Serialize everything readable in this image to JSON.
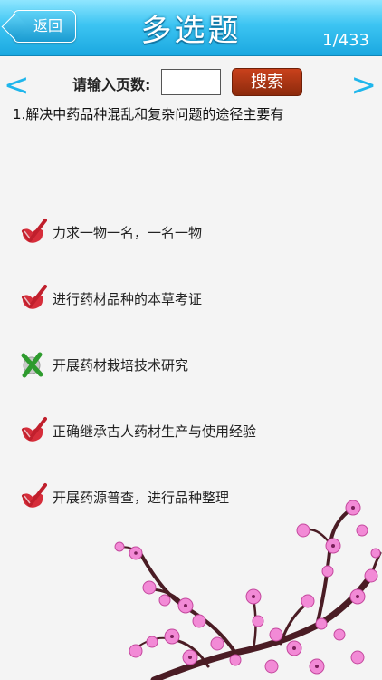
{
  "header": {
    "back_label": "返回",
    "title": "多选题",
    "page_count": "1/433"
  },
  "nav": {
    "prev_label": "<",
    "next_label": ">"
  },
  "search": {
    "page_label": "请输入页数:",
    "input_value": "",
    "button_label": "搜索"
  },
  "question": {
    "text": "1.解决中药品种混乱和复杂问题的途径主要有"
  },
  "options": [
    {
      "text": "力求一物一名，一名一物",
      "status": "check"
    },
    {
      "text": "进行药材品种的本草考证",
      "status": "check"
    },
    {
      "text": "开展药材栽培技术研究",
      "status": "cross"
    },
    {
      "text": "正确继承古人药材生产与使用经验",
      "status": "check"
    },
    {
      "text": "开展药源普查，进行品种整理",
      "status": "check"
    }
  ],
  "colors": {
    "header": "#3cc4f2",
    "arrow": "#1fb6ec",
    "search_button": "#a8361a",
    "check": "#d62d3a",
    "cross": "#2e9b2e",
    "blossom": "#f28ad6",
    "branch": "#4a1c24"
  },
  "icons": {
    "correct": "check-mark-icon",
    "wrong": "cross-mark-icon",
    "decoration": "plum-blossom-branch"
  }
}
